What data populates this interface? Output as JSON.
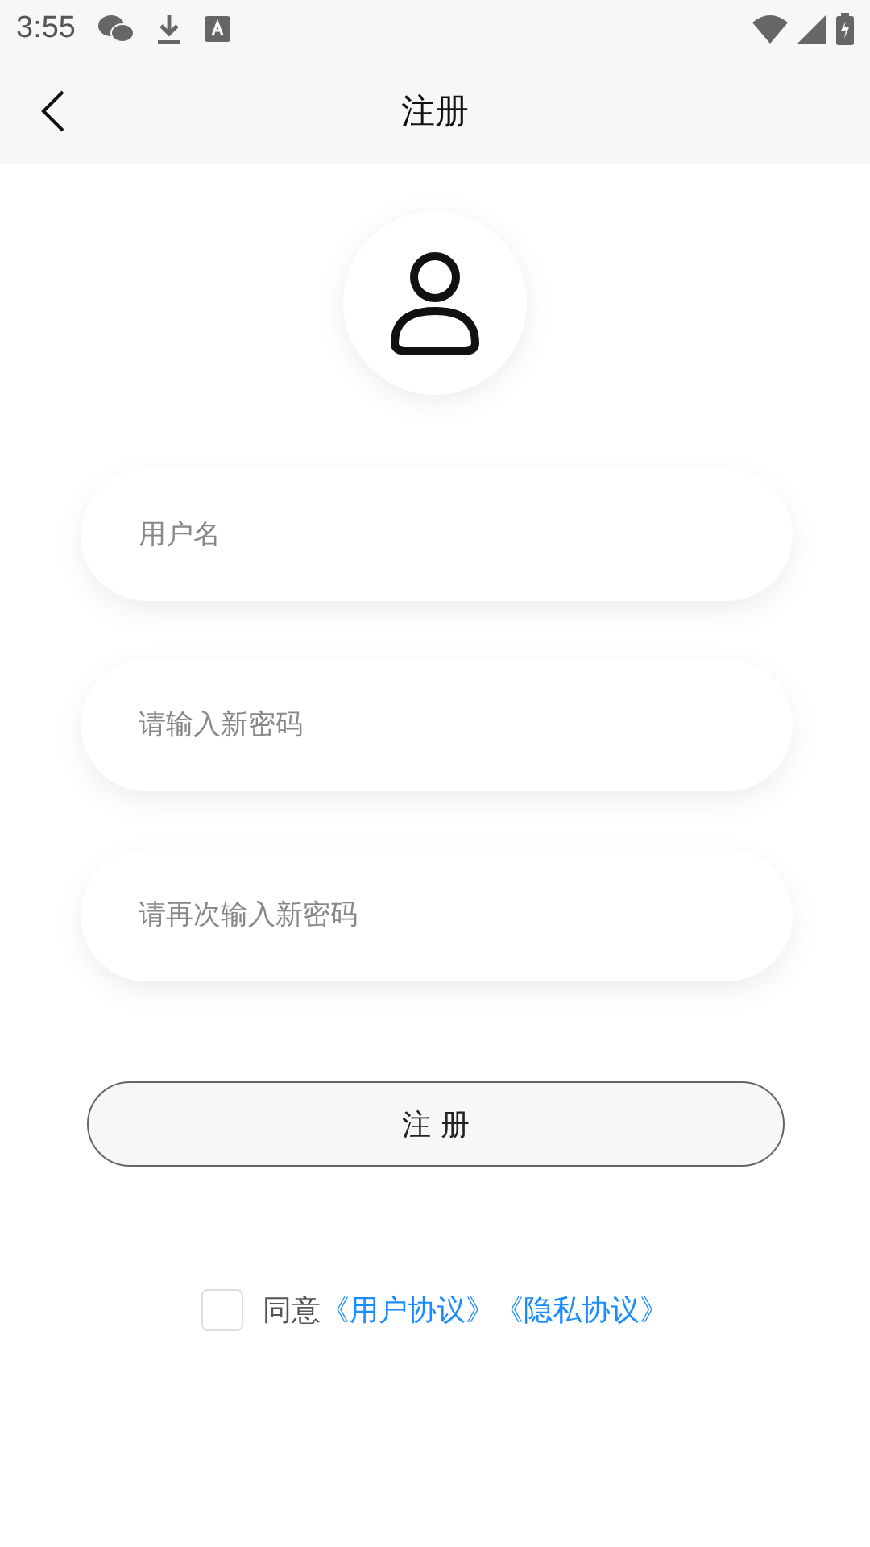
{
  "status_bar": {
    "time": "3:55"
  },
  "header": {
    "title": "注册"
  },
  "fields": [
    {
      "placeholder": "用户名"
    },
    {
      "placeholder": "请输入新密码"
    },
    {
      "placeholder": "请再次输入新密码"
    }
  ],
  "submit_button": "注 册",
  "agreement": {
    "checked": false,
    "text": "同意",
    "links": [
      "《用户协议》",
      "《隐私协议》"
    ]
  }
}
